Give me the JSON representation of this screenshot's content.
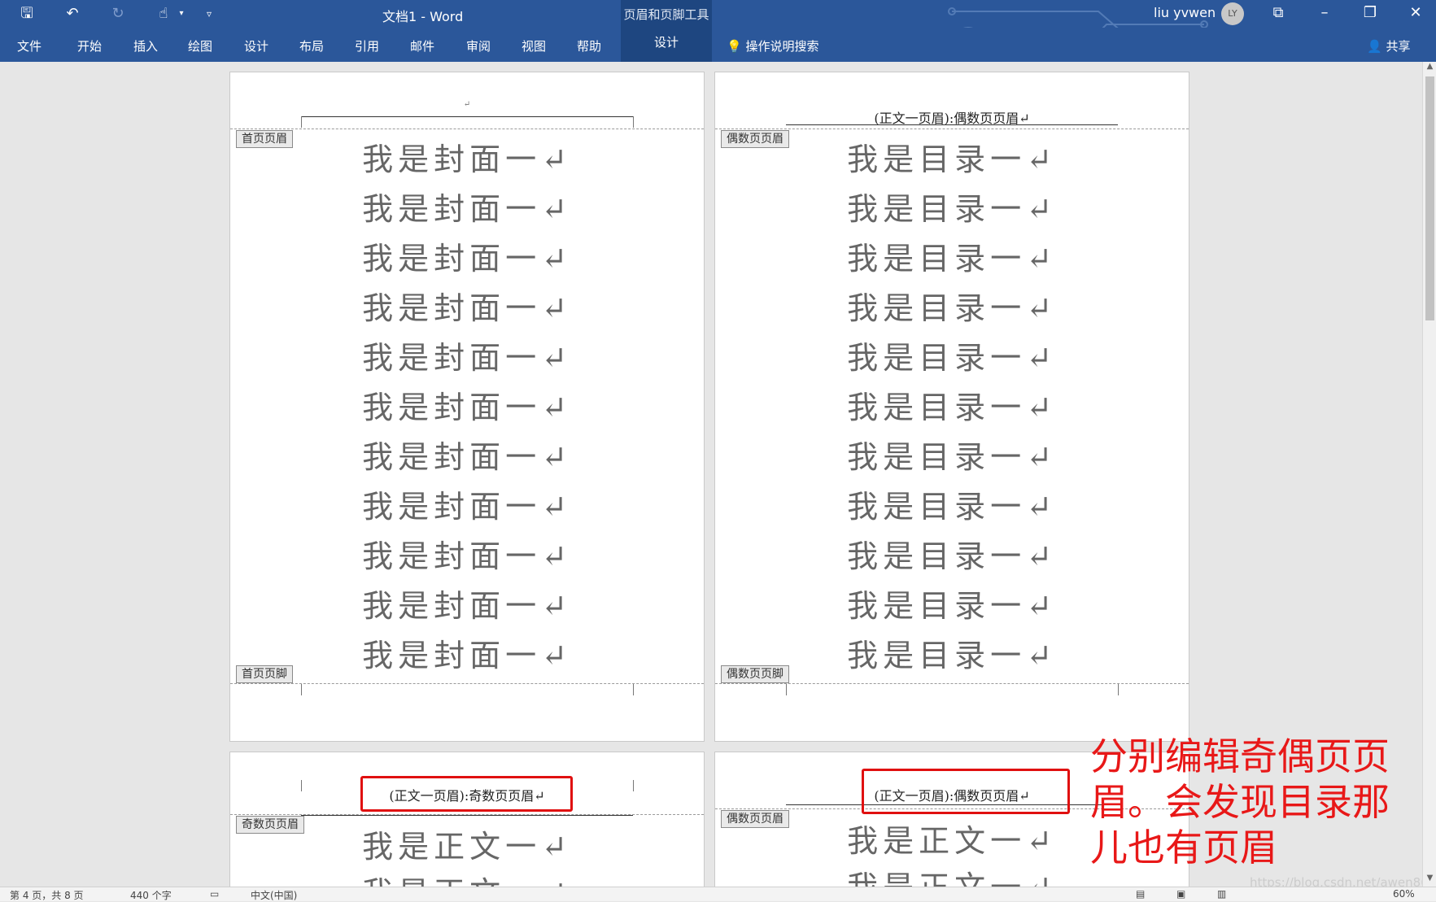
{
  "window": {
    "doc_title": "文档1  -  Word",
    "context_group_label": "页眉和页脚工具",
    "context_tab": "设计",
    "user_name": "liu yvwen",
    "avatar_initials": "LY"
  },
  "ribbon_tabs": [
    "文件",
    "开始",
    "插入",
    "绘图",
    "设计",
    "布局",
    "引用",
    "邮件",
    "审阅",
    "视图",
    "帮助"
  ],
  "tell_me": "操作说明搜索",
  "share": "共享",
  "pages": {
    "p1": {
      "header_tag": "首页页眉",
      "footer_tag": "首页页脚",
      "header_text": "↵",
      "lines": [
        "我是封面一↵",
        "我是封面一↵",
        "我是封面一↵",
        "我是封面一↵",
        "我是封面一↵",
        "我是封面一↵",
        "我是封面一↵",
        "我是封面一↵",
        "我是封面一↵",
        "我是封面一↵",
        "我是封面一↵"
      ]
    },
    "p2": {
      "header_tag": "偶数页页眉",
      "footer_tag": "偶数页页脚",
      "header_text": "(正文一页眉):偶数页页眉↵",
      "lines": [
        "我是目录一↵",
        "我是目录一↵",
        "我是目录一↵",
        "我是目录一↵",
        "我是目录一↵",
        "我是目录一↵",
        "我是目录一↵",
        "我是目录一↵",
        "我是目录一↵",
        "我是目录一↵",
        "我是目录一↵"
      ]
    },
    "p3": {
      "header_tag": "奇数页页眉",
      "header_text": "(正文一页眉):奇数页页眉↵",
      "lines": [
        "我是正文一↵",
        "我是正文一↵"
      ]
    },
    "p4": {
      "header_tag": "偶数页页眉",
      "header_text": "(正文一页眉):偶数页页眉↵",
      "lines": [
        "我是正文一↵",
        "我是正文一↵"
      ]
    }
  },
  "annotation": "分别编辑奇偶页页眉。会发现目录那儿也有页眉",
  "status": {
    "page": "第 4 页，共 8 页",
    "words": "440 个字",
    "lang": "中文(中国)",
    "zoom": "60%"
  },
  "watermark": "https://blog.csdn.net/awen8666",
  "colors": {
    "ribbon": "#2b579a",
    "context": "#1e4680",
    "annotation_red": "#e01010"
  }
}
